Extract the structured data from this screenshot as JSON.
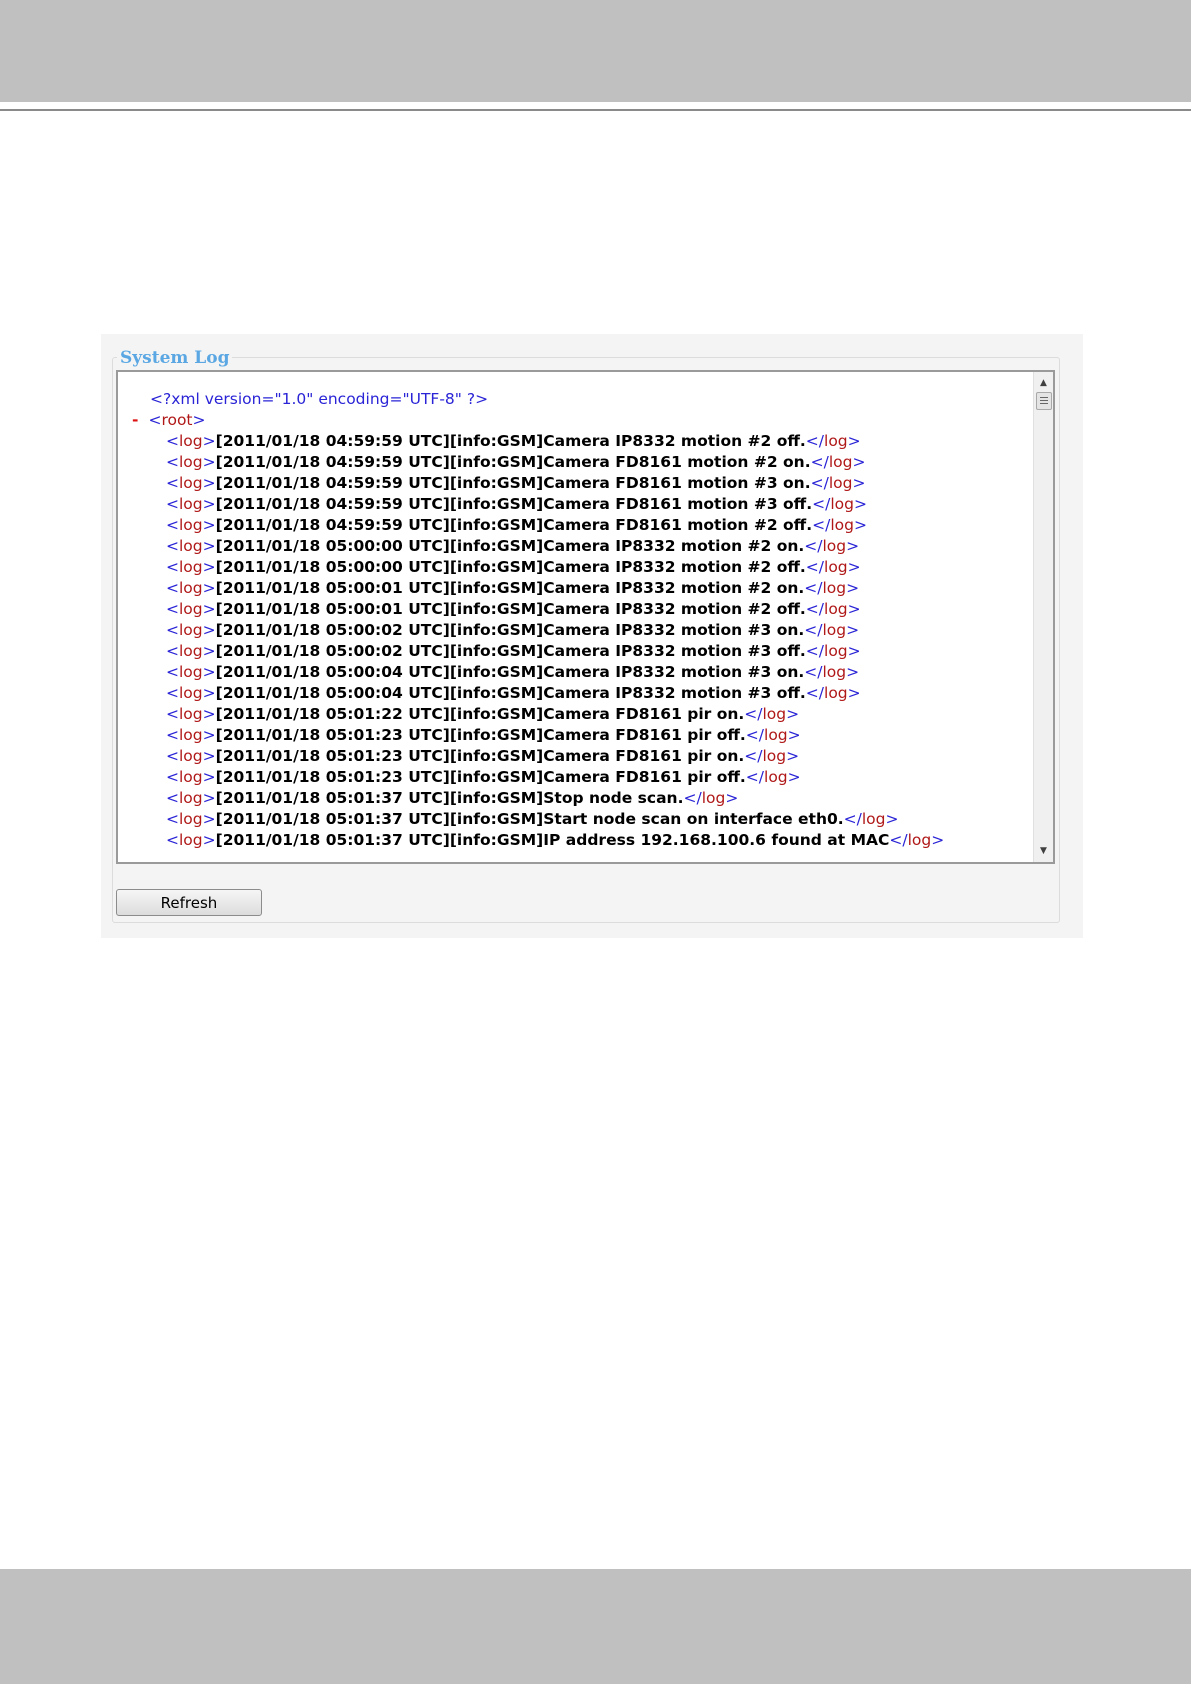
{
  "panel": {
    "legend": "System Log",
    "refresh_label": "Refresh"
  },
  "log": {
    "declaration": "<?xml version=\"1.0\" encoding=\"UTF-8\" ?>",
    "collapse_marker": "-",
    "root_tag": "root",
    "entry_tag": "log",
    "entries": [
      "[2011/01/18 04:59:59 UTC][info:GSM]Camera IP8332 motion #2 off.",
      "[2011/01/18 04:59:59 UTC][info:GSM]Camera FD8161 motion #2 on.",
      "[2011/01/18 04:59:59 UTC][info:GSM]Camera FD8161 motion #3 on.",
      "[2011/01/18 04:59:59 UTC][info:GSM]Camera FD8161 motion #3 off.",
      "[2011/01/18 04:59:59 UTC][info:GSM]Camera FD8161 motion #2 off.",
      "[2011/01/18 05:00:00 UTC][info:GSM]Camera IP8332 motion #2 on.",
      "[2011/01/18 05:00:00 UTC][info:GSM]Camera IP8332 motion #2 off.",
      "[2011/01/18 05:00:01 UTC][info:GSM]Camera IP8332 motion #2 on.",
      "[2011/01/18 05:00:01 UTC][info:GSM]Camera IP8332 motion #2 off.",
      "[2011/01/18 05:00:02 UTC][info:GSM]Camera IP8332 motion #3 on.",
      "[2011/01/18 05:00:02 UTC][info:GSM]Camera IP8332 motion #3 off.",
      "[2011/01/18 05:00:04 UTC][info:GSM]Camera IP8332 motion #3 on.",
      "[2011/01/18 05:00:04 UTC][info:GSM]Camera IP8332 motion #3 off.",
      "[2011/01/18 05:01:22 UTC][info:GSM]Camera FD8161 pir on.",
      "[2011/01/18 05:01:23 UTC][info:GSM]Camera FD8161 pir off.",
      "[2011/01/18 05:01:23 UTC][info:GSM]Camera FD8161 pir on.",
      "[2011/01/18 05:01:23 UTC][info:GSM]Camera FD8161 pir off.",
      "[2011/01/18 05:01:37 UTC][info:GSM]Stop node scan.",
      "[2011/01/18 05:01:37 UTC][info:GSM]Start node scan on interface eth0.",
      "[2011/01/18 05:01:37 UTC][info:GSM]IP address 192.168.100.6 found at MAC"
    ]
  },
  "scrollbar": {
    "up_icon": "▲",
    "down_icon": "▼"
  }
}
